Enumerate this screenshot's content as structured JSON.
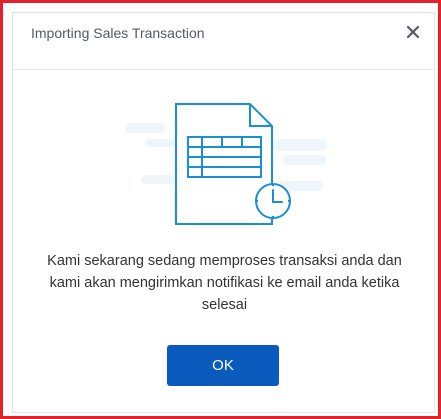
{
  "dialog": {
    "title": "Importing Sales Transaction",
    "close_icon": "close-icon",
    "illustration": "spreadsheet-document-clock-icon",
    "message": "Kami sekarang sedang memproses transaksi anda dan kami akan mengirimkan notifikasi ke email anda ketika selesai",
    "ok_label": "OK"
  },
  "colors": {
    "frame_border": "#e4202a",
    "primary_button": "#0b5bbf",
    "icon_stroke": "#1a8fd8",
    "cloud_fill": "#eef5fb"
  }
}
